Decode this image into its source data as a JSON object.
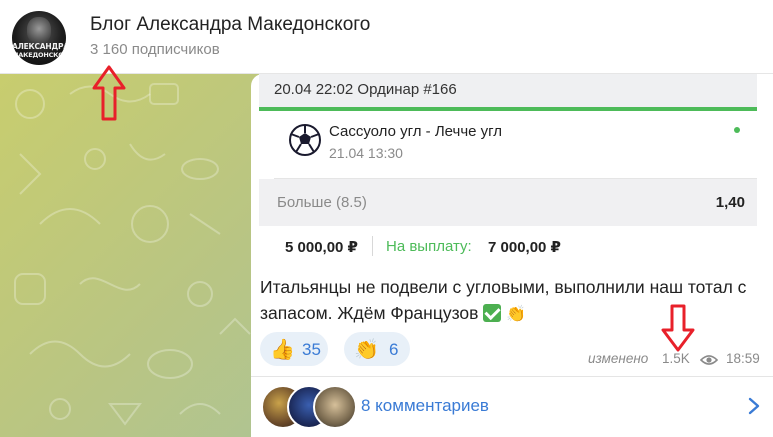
{
  "header": {
    "channel_title": "Блог Александра Македонского",
    "subscribers": "3 160 подписчиков",
    "avatar_text_line1": "АЛЕКСАНДРА",
    "avatar_text_line2": "МАКЕДОНСКОГО"
  },
  "bet_card": {
    "header": "20.04 22:02 Ординар  #166",
    "match": "Сассуоло угл - Лечче угл",
    "date": "21.04 13:30",
    "market": "Больше (8.5)",
    "odds": "1,40",
    "stake": "5 000,00 ₽",
    "payout_label": "На выплату:",
    "payout_value": "7 000,00 ₽",
    "accent_color": "#4dbb59"
  },
  "message": {
    "text": "Итальянцы не подвели с угловыми, выполнили наш тотал с запасом. Ждём Французов",
    "edited": "изменено",
    "views": "1.5K",
    "time": "18:59"
  },
  "reactions": [
    {
      "emoji": "👍",
      "count": "35"
    },
    {
      "emoji": "👏",
      "count": "6"
    }
  ],
  "comments": {
    "label": "8 комментариев"
  },
  "icons": {
    "eye": "eye-icon",
    "chevron": "chevron-right-icon",
    "ball": "soccer-ball-icon",
    "arrow_color": "#e8202a"
  }
}
